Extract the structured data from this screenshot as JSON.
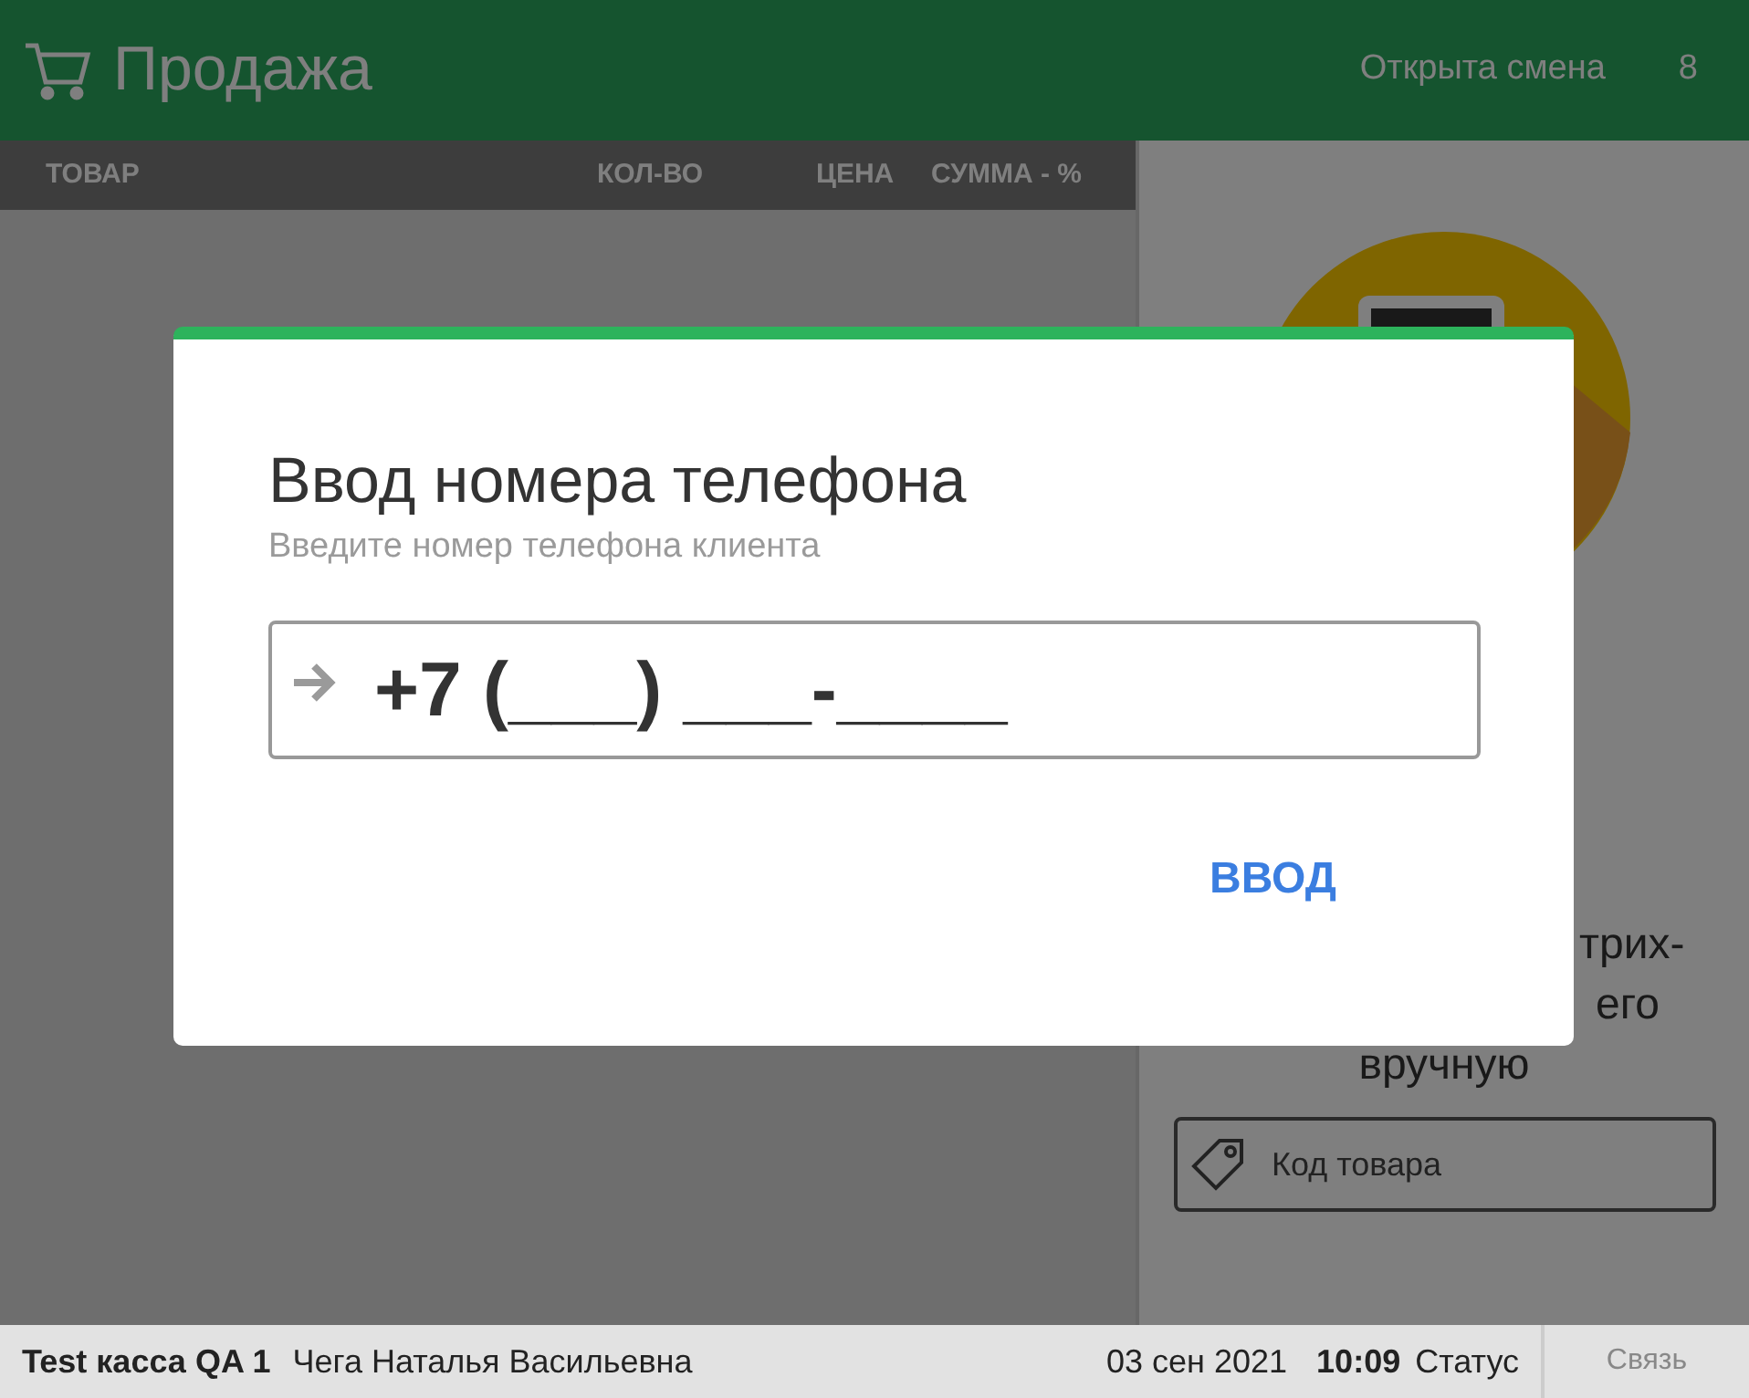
{
  "header": {
    "title": "Продажа",
    "shift_status": "Открыта смена",
    "shift_number": "8"
  },
  "table": {
    "columns": [
      "ТОВАР",
      "КОЛ-ВО",
      "ЦЕНА",
      "СУММА - %"
    ]
  },
  "right_panel": {
    "hint_lines": [
      "трих-",
      "его",
      "вручную"
    ],
    "code_field": {
      "placeholder": "Код товара"
    }
  },
  "dialog": {
    "title": "Ввод номера телефона",
    "subtitle": "Введите номер телефона клиента",
    "phone_field": {
      "value": "+7 (___) ___-____"
    },
    "button": "ВВОД"
  },
  "status_bar": {
    "register": "Test касса QA 1",
    "cashier": "Чега Наталья Васильевна",
    "date": "03 сен 2021",
    "time": "10:09",
    "status": "Статус",
    "connection": "Связь"
  }
}
